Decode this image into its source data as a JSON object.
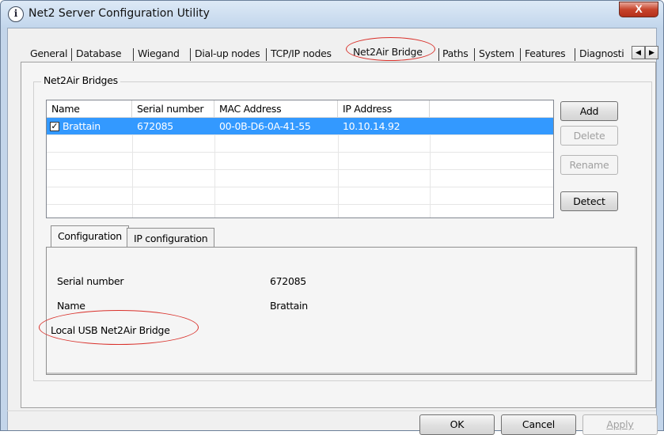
{
  "window": {
    "title": "Net2 Server Configuration Utility",
    "close_label": "X"
  },
  "main_tabs": [
    {
      "label": "General"
    },
    {
      "label": "Database"
    },
    {
      "label": "Wiegand"
    },
    {
      "label": "Dial-up nodes"
    },
    {
      "label": "TCP/IP nodes"
    },
    {
      "label": "Net2Air Bridge",
      "active": true
    },
    {
      "label": "Paths"
    },
    {
      "label": "System"
    },
    {
      "label": "Features"
    },
    {
      "label": "Diagnosti"
    }
  ],
  "group": {
    "label": "Net2Air Bridges"
  },
  "bridges_list": {
    "columns": [
      "Name",
      "Serial number",
      "MAC Address",
      "IP Address"
    ],
    "rows": [
      {
        "checked": true,
        "name": "Brattain",
        "serial": "672085",
        "mac": "00-0B-D6-0A-41-55",
        "ip": "10.10.14.92",
        "selected": true
      }
    ]
  },
  "list_buttons": {
    "add": "Add",
    "delete": "Delete",
    "rename": "Rename",
    "detect": "Detect"
  },
  "inner_tabs": [
    {
      "label": "Configuration",
      "active": true
    },
    {
      "label": "IP configuration"
    }
  ],
  "configuration": {
    "serial_label": "Serial number",
    "serial_value": "672085",
    "name_label": "Name",
    "name_value": "Brattain",
    "local_usb_label": "Local USB Net2Air Bridge"
  },
  "dialog_buttons": {
    "ok": "OK",
    "cancel": "Cancel",
    "apply": "Apply"
  },
  "colors": {
    "selection": "#3399ff",
    "highlight_ring": "#d9312b",
    "close_button": "#c7442c"
  }
}
